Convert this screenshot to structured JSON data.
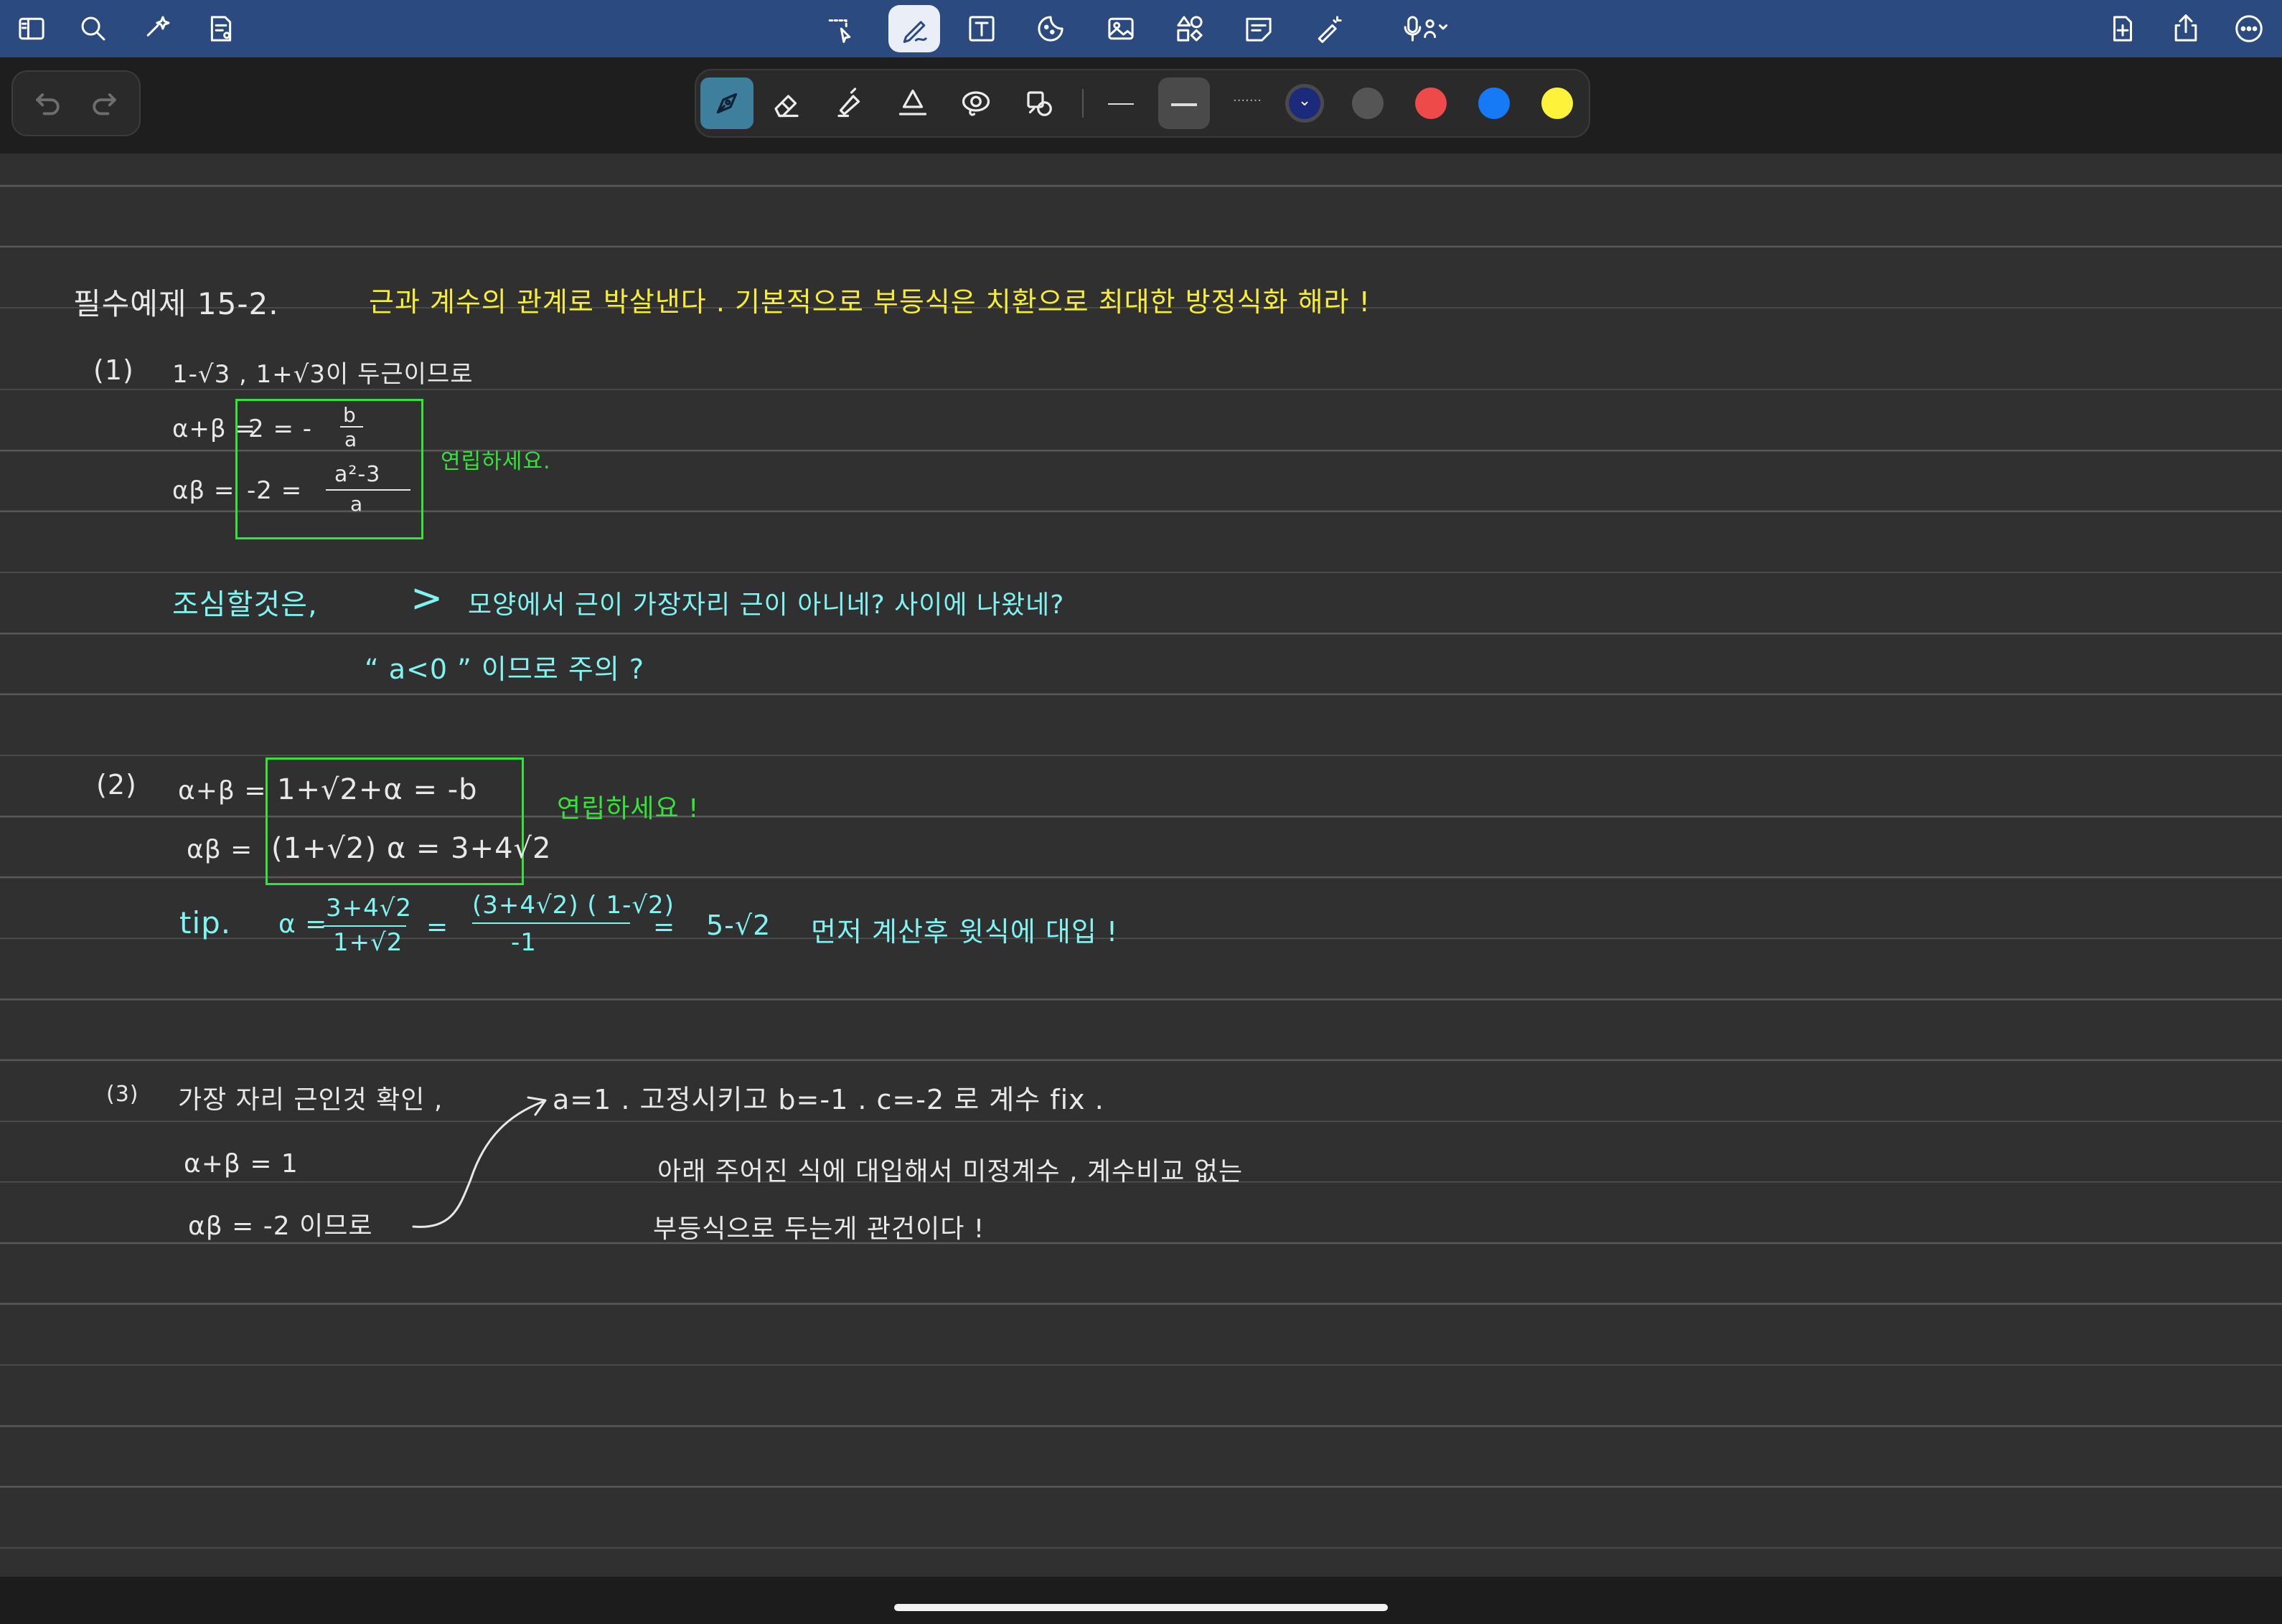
{
  "toolbar": {
    "left": [
      "sidebar-icon",
      "search-icon",
      "ai-sparkle-icon",
      "document-view-icon"
    ],
    "center": [
      "lasso-icon",
      "pen-icon",
      "text-box-icon",
      "sticker-icon",
      "image-icon",
      "shapes-icon",
      "sticky-note-icon",
      "laser-pointer-icon",
      "microphone-icon"
    ],
    "right": [
      "add-page-icon",
      "share-icon",
      "more-icon"
    ],
    "active_tool": "pen-icon"
  },
  "palette": {
    "tools": [
      "fountain-pen-icon",
      "eraser-icon",
      "highlighter-icon",
      "shape-tool-icon",
      "lasso-tool-icon",
      "magic-tool-icon"
    ],
    "active_tool": "fountain-pen-icon",
    "thickness_selected": "medium",
    "dotted_label": "·······",
    "colors": [
      "#1b2a7a",
      "#555555",
      "#ef4a4a",
      "#1679f5",
      "#fff23a"
    ],
    "selected_color": "#1b2a7a",
    "chevron": "⌄"
  },
  "notes": {
    "title": "필수예제 15-2.",
    "title_note": "근과 계수의 관계로 박살낸다 . 기본적으로 부등식은 치환으로 최대한 방정식화 해라 !",
    "p1": {
      "label": "(1)",
      "roots": "1-√3 , 1+√3이 두근이므로",
      "sum_lhs": "α+β =",
      "sum_eq": "2 = -",
      "sum_num": "b",
      "sum_den": "a",
      "prod_lhs": "αβ =",
      "prod_eq": "-2 =",
      "prod_num": "a²-3",
      "prod_den": "a",
      "solve": "연립하세요.",
      "caution_lead": "조심할것은,",
      "caution_sym": ">",
      "caution_text": "모양에서 근이 가장자리 근이 아니네? 사이에 나왔네?",
      "caution_2": "“ a<0 ” 이므로 주의 ?"
    },
    "p2": {
      "label": "(2)",
      "sum_lhs": "α+β =",
      "sum_rhs": "1+√2+α = -b",
      "prod_lhs": "αβ =",
      "prod_rhs": "(1+√2) α = 3+4√2",
      "solve": "연립하세요 !",
      "tip": "tip.",
      "alpha": "α =",
      "f1_num": "3+4√2",
      "f1_den": "1+√2",
      "eq": "=",
      "f2_num": "(3+4√2) ( 1-√2)",
      "f2_den": "-1",
      "eq2": "=",
      "result": "5-√2",
      "after": "먼저 계산후 윗식에 대입 !"
    },
    "p3": {
      "label": "(3)",
      "check": "가장 자리 근인것 확인 ,",
      "a_fix": "a=1 . 고정시키고 b=-1 . c=-2 로 계수 fix .",
      "sum": "α+β = 1",
      "prod": "αβ = -2 이므로",
      "line1": "아래 주어진 식에 대입해서 미정계수 , 계수비교 없는",
      "line2": "부등식으로 두는게 관건이다 !"
    }
  }
}
